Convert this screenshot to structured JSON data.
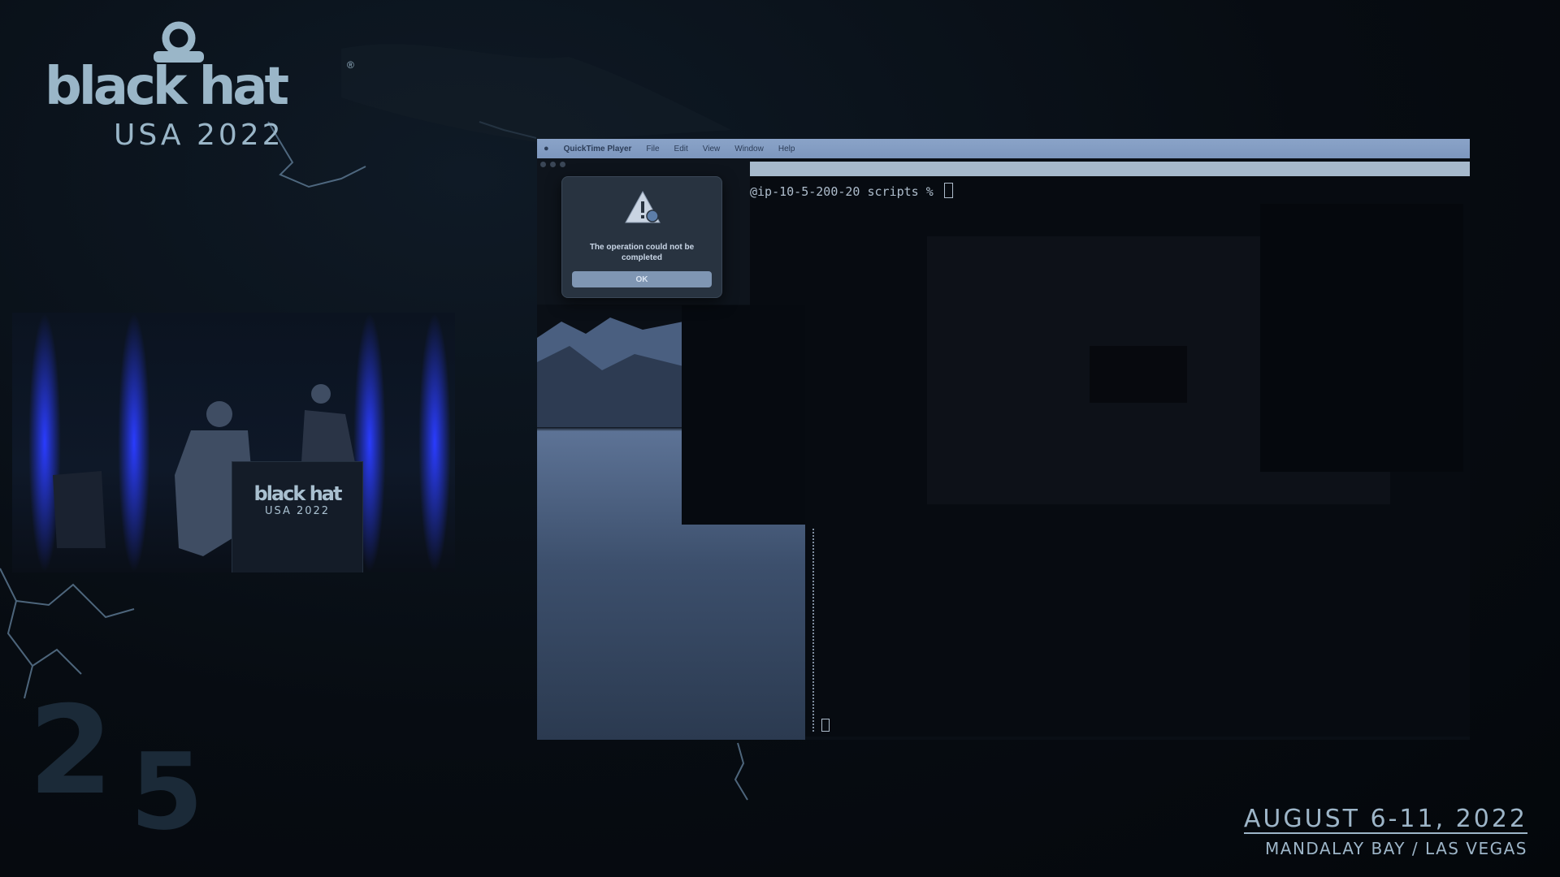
{
  "logo": {
    "wordmark": "black hat",
    "registered": "®",
    "subtitle": "USA 2022"
  },
  "podium_logo": {
    "wordmark": "black hat",
    "subtitle": "USA 2022"
  },
  "event": {
    "date": "AUGUST 6-11, 2022",
    "venue": "MANDALAY BAY / LAS VEGAS"
  },
  "decor_numbers": [
    "2",
    "5"
  ],
  "screen": {
    "menubar": {
      "apple_icon": "apple-icon",
      "app_name": "QuickTime Player",
      "items": [
        "File",
        "Edit",
        "View",
        "Window",
        "Help"
      ]
    },
    "terminal": {
      "prompt": "@ip-10-5-200-20 scripts % "
    },
    "alert": {
      "icon": "warning-icon",
      "message": "The operation could not be completed",
      "button_label": "OK"
    }
  },
  "colors": {
    "accent": "#9ab6c8",
    "menubar": "#8aa3c8",
    "background": "#070c12"
  }
}
